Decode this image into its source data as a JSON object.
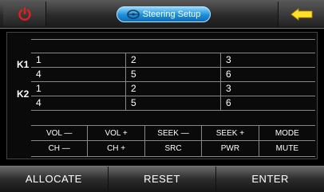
{
  "header": {
    "title": "Steering Setup",
    "power_icon": "power-icon",
    "back_icon": "back-arrow-icon",
    "steering_icon": "steering-wheel-icon",
    "accent_power": "#e02020",
    "accent_back": "#ffdf2a",
    "accent_title": "#1c8ed8"
  },
  "keys": {
    "k1": "K1",
    "k2": "K2",
    "rows": [
      [
        "1",
        "2",
        "3"
      ],
      [
        "4",
        "5",
        "6"
      ],
      [
        "1",
        "2",
        "3"
      ],
      [
        "4",
        "5",
        "6"
      ]
    ]
  },
  "functions": {
    "row1": [
      "VOL —",
      "VOL +",
      "SEEK —",
      "SEEK +",
      "MODE"
    ],
    "row2": [
      "CH —",
      "CH +",
      "SRC",
      "PWR",
      "MUTE"
    ]
  },
  "footer": {
    "allocate": "ALLOCATE",
    "reset": "RESET",
    "enter": "ENTER"
  }
}
